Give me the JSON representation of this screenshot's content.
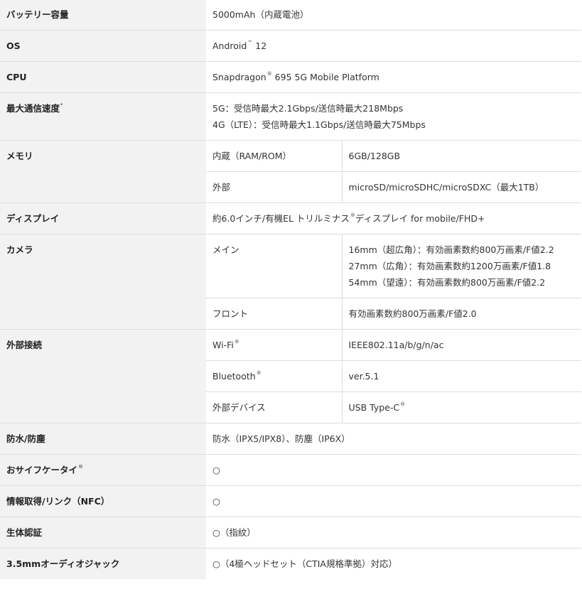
{
  "rows": [
    {
      "key": "battery",
      "label": "バッテリー容量",
      "value": "5000mAh（内蔵電池）"
    },
    {
      "key": "os",
      "label": "OS",
      "value_text": "Android",
      "value_mark": "™",
      "value_suffix": " 12"
    },
    {
      "key": "cpu",
      "label": "CPU",
      "value_text": "Snapdragon",
      "value_mark": "®",
      "value_suffix": " 695 5G Mobile Platform"
    },
    {
      "key": "speed",
      "label": "最大通信速度",
      "label_mark": "*",
      "lines": [
        "5G：受信時最大2.1Gbps/送信時最大218Mbps",
        "4G（LTE）：受信時最大1.1Gbps/送信時最大75Mbps"
      ]
    },
    {
      "key": "memory",
      "label": "メモリ",
      "subs": [
        {
          "name": "内蔵（RAM/ROM）",
          "value": "6GB/128GB"
        },
        {
          "name": "外部",
          "value": "microSD/microSDHC/microSDXC（最大1TB）"
        }
      ]
    },
    {
      "key": "display",
      "label": "ディスプレイ",
      "value_text": "約6.0インチ/有機EL トリルミナス",
      "value_mark": "®",
      "value_suffix": "ディスプレイ for mobile/FHD+"
    },
    {
      "key": "camera",
      "label": "カメラ",
      "subs": [
        {
          "name": "メイン",
          "lines": [
            "16mm（超広角）：有効画素数約800万画素/F値2.2",
            "27mm（広角）：有効画素数約1200万画素/F値1.8",
            "54mm（望遠）：有効画素数約800万画素/F値2.2"
          ]
        },
        {
          "name": "フロント",
          "value": "有効画素数約800万画素/F値2.0"
        }
      ]
    },
    {
      "key": "connect",
      "label": "外部接続",
      "subs": [
        {
          "name": "Wi-Fi",
          "name_mark": "®",
          "value": "IEEE802.11a/b/g/n/ac"
        },
        {
          "name": "Bluetooth",
          "name_mark": "®",
          "value": "ver.5.1"
        },
        {
          "name": "外部デバイス",
          "value": "USB Type-C",
          "value_mark": "®"
        }
      ]
    },
    {
      "key": "water",
      "label": "防水/防塵",
      "value": "防水（IPX5/IPX8）、防塵（IP6X）"
    },
    {
      "key": "osaifu",
      "label": "おサイフケータイ",
      "label_mark": "®",
      "value": "○"
    },
    {
      "key": "nfc",
      "label": "情報取得/リンク（NFC）",
      "value": "○"
    },
    {
      "key": "bio",
      "label": "生体認証",
      "value": "○（指紋）"
    },
    {
      "key": "audio",
      "label": "3.5mmオーディオジャック",
      "value": "○（4極ヘッドセット（CTIA規格準拠）対応）"
    }
  ]
}
